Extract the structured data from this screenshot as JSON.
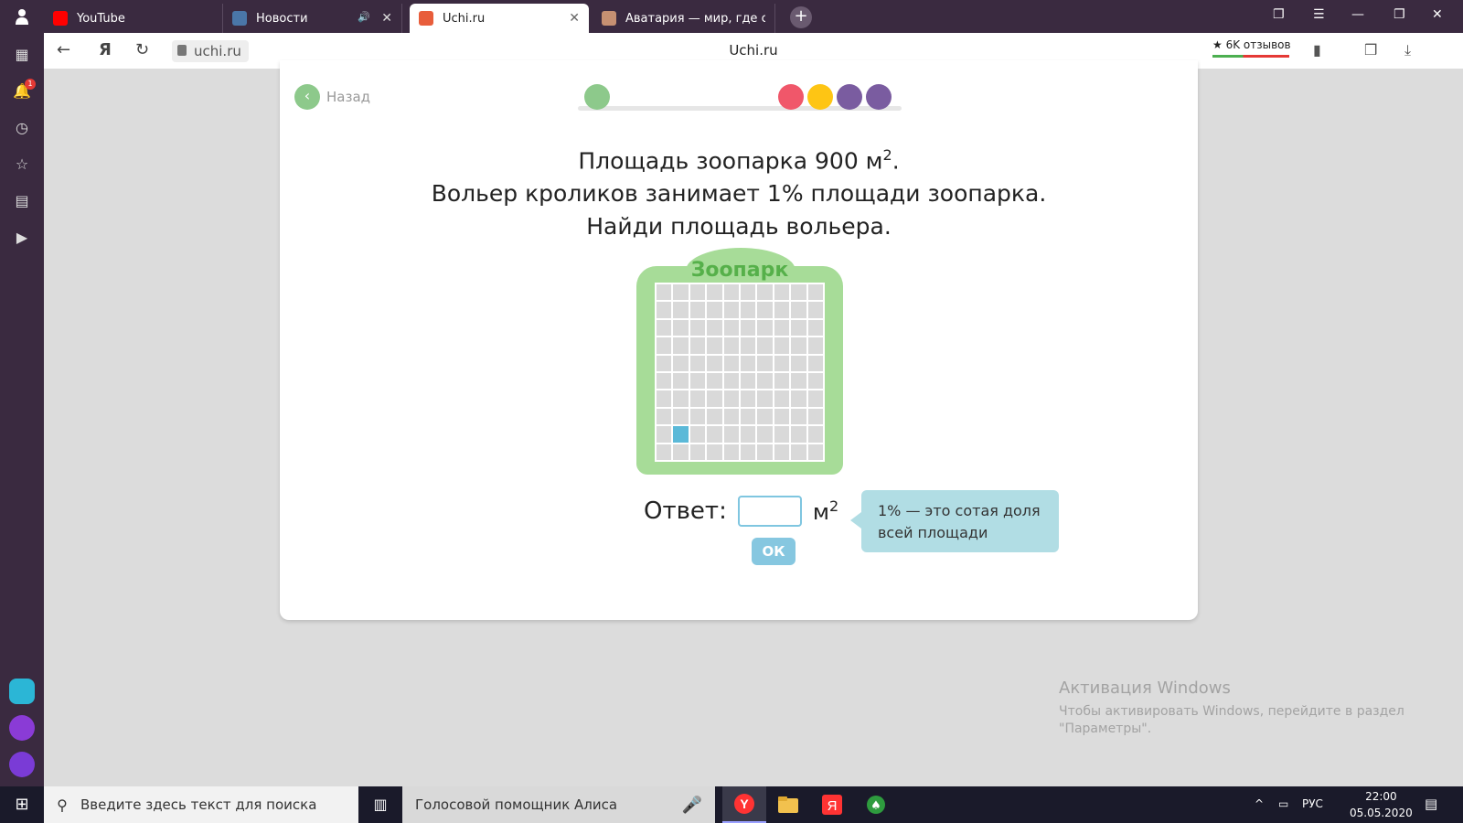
{
  "browser": {
    "tabs": [
      {
        "title": "YouTube",
        "favicon_color": "#ff0000"
      },
      {
        "title": "Новости",
        "favicon_color": "#4a76a8"
      },
      {
        "title": "Uchi.ru",
        "favicon_color": "#e85d3b"
      },
      {
        "title": "Аватария — мир, где сбы",
        "favicon_color": "#c69072"
      }
    ],
    "url": "uchi.ru",
    "site_title": "Uchi.ru",
    "reviews": "★ 6K отзывов",
    "notification_count": "1"
  },
  "page": {
    "back_label": "Назад",
    "progress_dots": [
      "#8dc98b",
      "#f0576a",
      "#fec514",
      "#7a5ca0",
      "#7a5ca0"
    ],
    "task_line1": "Площадь зоопарка 900 м",
    "task_line1_sup": "2",
    "task_line1_end": ".",
    "task_line2": "Вольер кроликов занимает 1% площади зоопарка.",
    "task_line3": "Найди площадь вольера.",
    "zoo_title": "Зоопарк",
    "answer_label": "Ответ:",
    "answer_value": "",
    "answer_unit": "м",
    "answer_unit_sup": "2",
    "ok_label": "ОК",
    "hint": "1% — это сотая доля всей площади"
  },
  "windows_activation": {
    "title": "Активация Windows",
    "line1": "Чтобы активировать Windows, перейдите в раздел",
    "line2": "\"Параметры\"."
  },
  "taskbar": {
    "search_placeholder": "Введите здесь текст для поиска",
    "alice_label": "Голосовой помощник Алиса",
    "lang": "РУС",
    "time": "22:00",
    "date": "05.05.2020"
  }
}
